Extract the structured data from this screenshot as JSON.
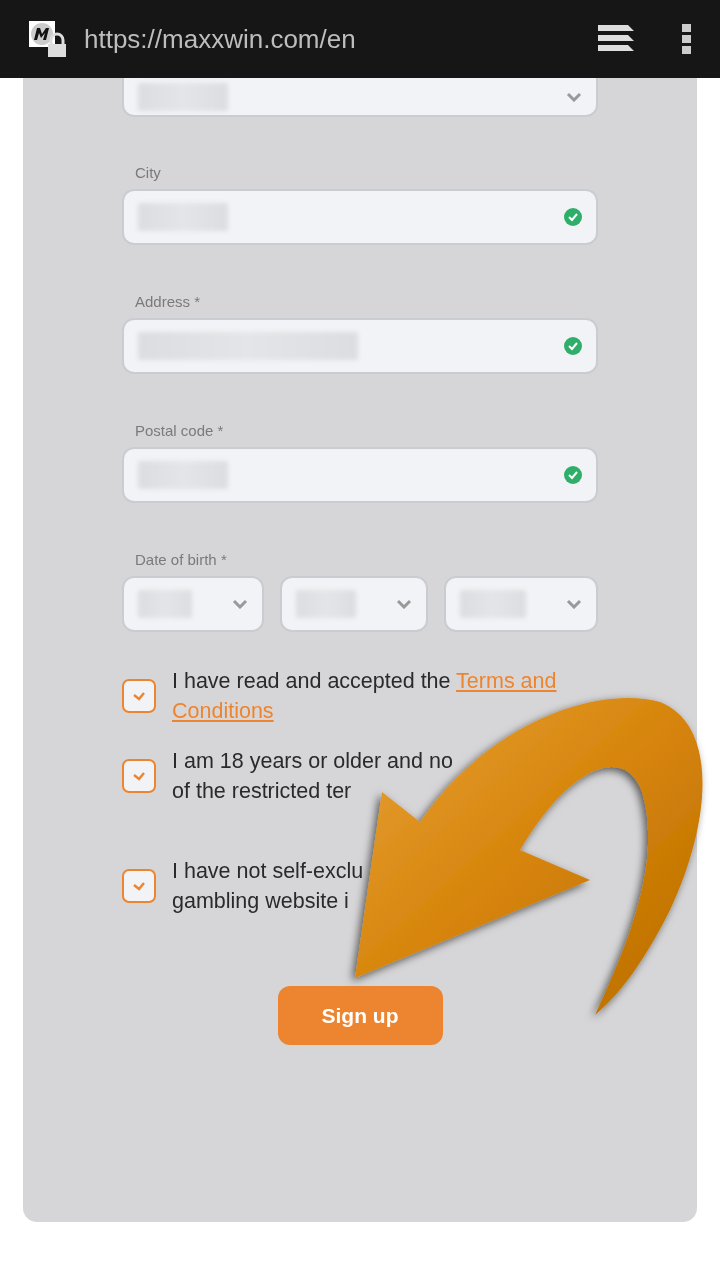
{
  "browser": {
    "url": "https://maxxwin.com/en"
  },
  "fields": [
    {
      "kind": "select",
      "valid": false,
      "cut": true
    },
    {
      "kind": "text",
      "label": "City",
      "valid": true
    },
    {
      "kind": "text",
      "label": "Address *",
      "valid": true
    },
    {
      "kind": "text",
      "label": "Postal code *",
      "valid": true
    }
  ],
  "date_of_birth": {
    "label": "Date of birth *"
  },
  "agreements": [
    {
      "checked": true,
      "lines": [
        "I have read and accepted the "
      ],
      "link": [
        "Terms and",
        "Conditions"
      ]
    },
    {
      "checked": true,
      "lines": [
        "I am 18 years or older and no",
        "of the restricted ter"
      ]
    },
    {
      "checked": true,
      "lines": [
        "I have not self-exclu",
        "gambling website i"
      ]
    }
  ],
  "submit": {
    "label": "Sign up"
  }
}
